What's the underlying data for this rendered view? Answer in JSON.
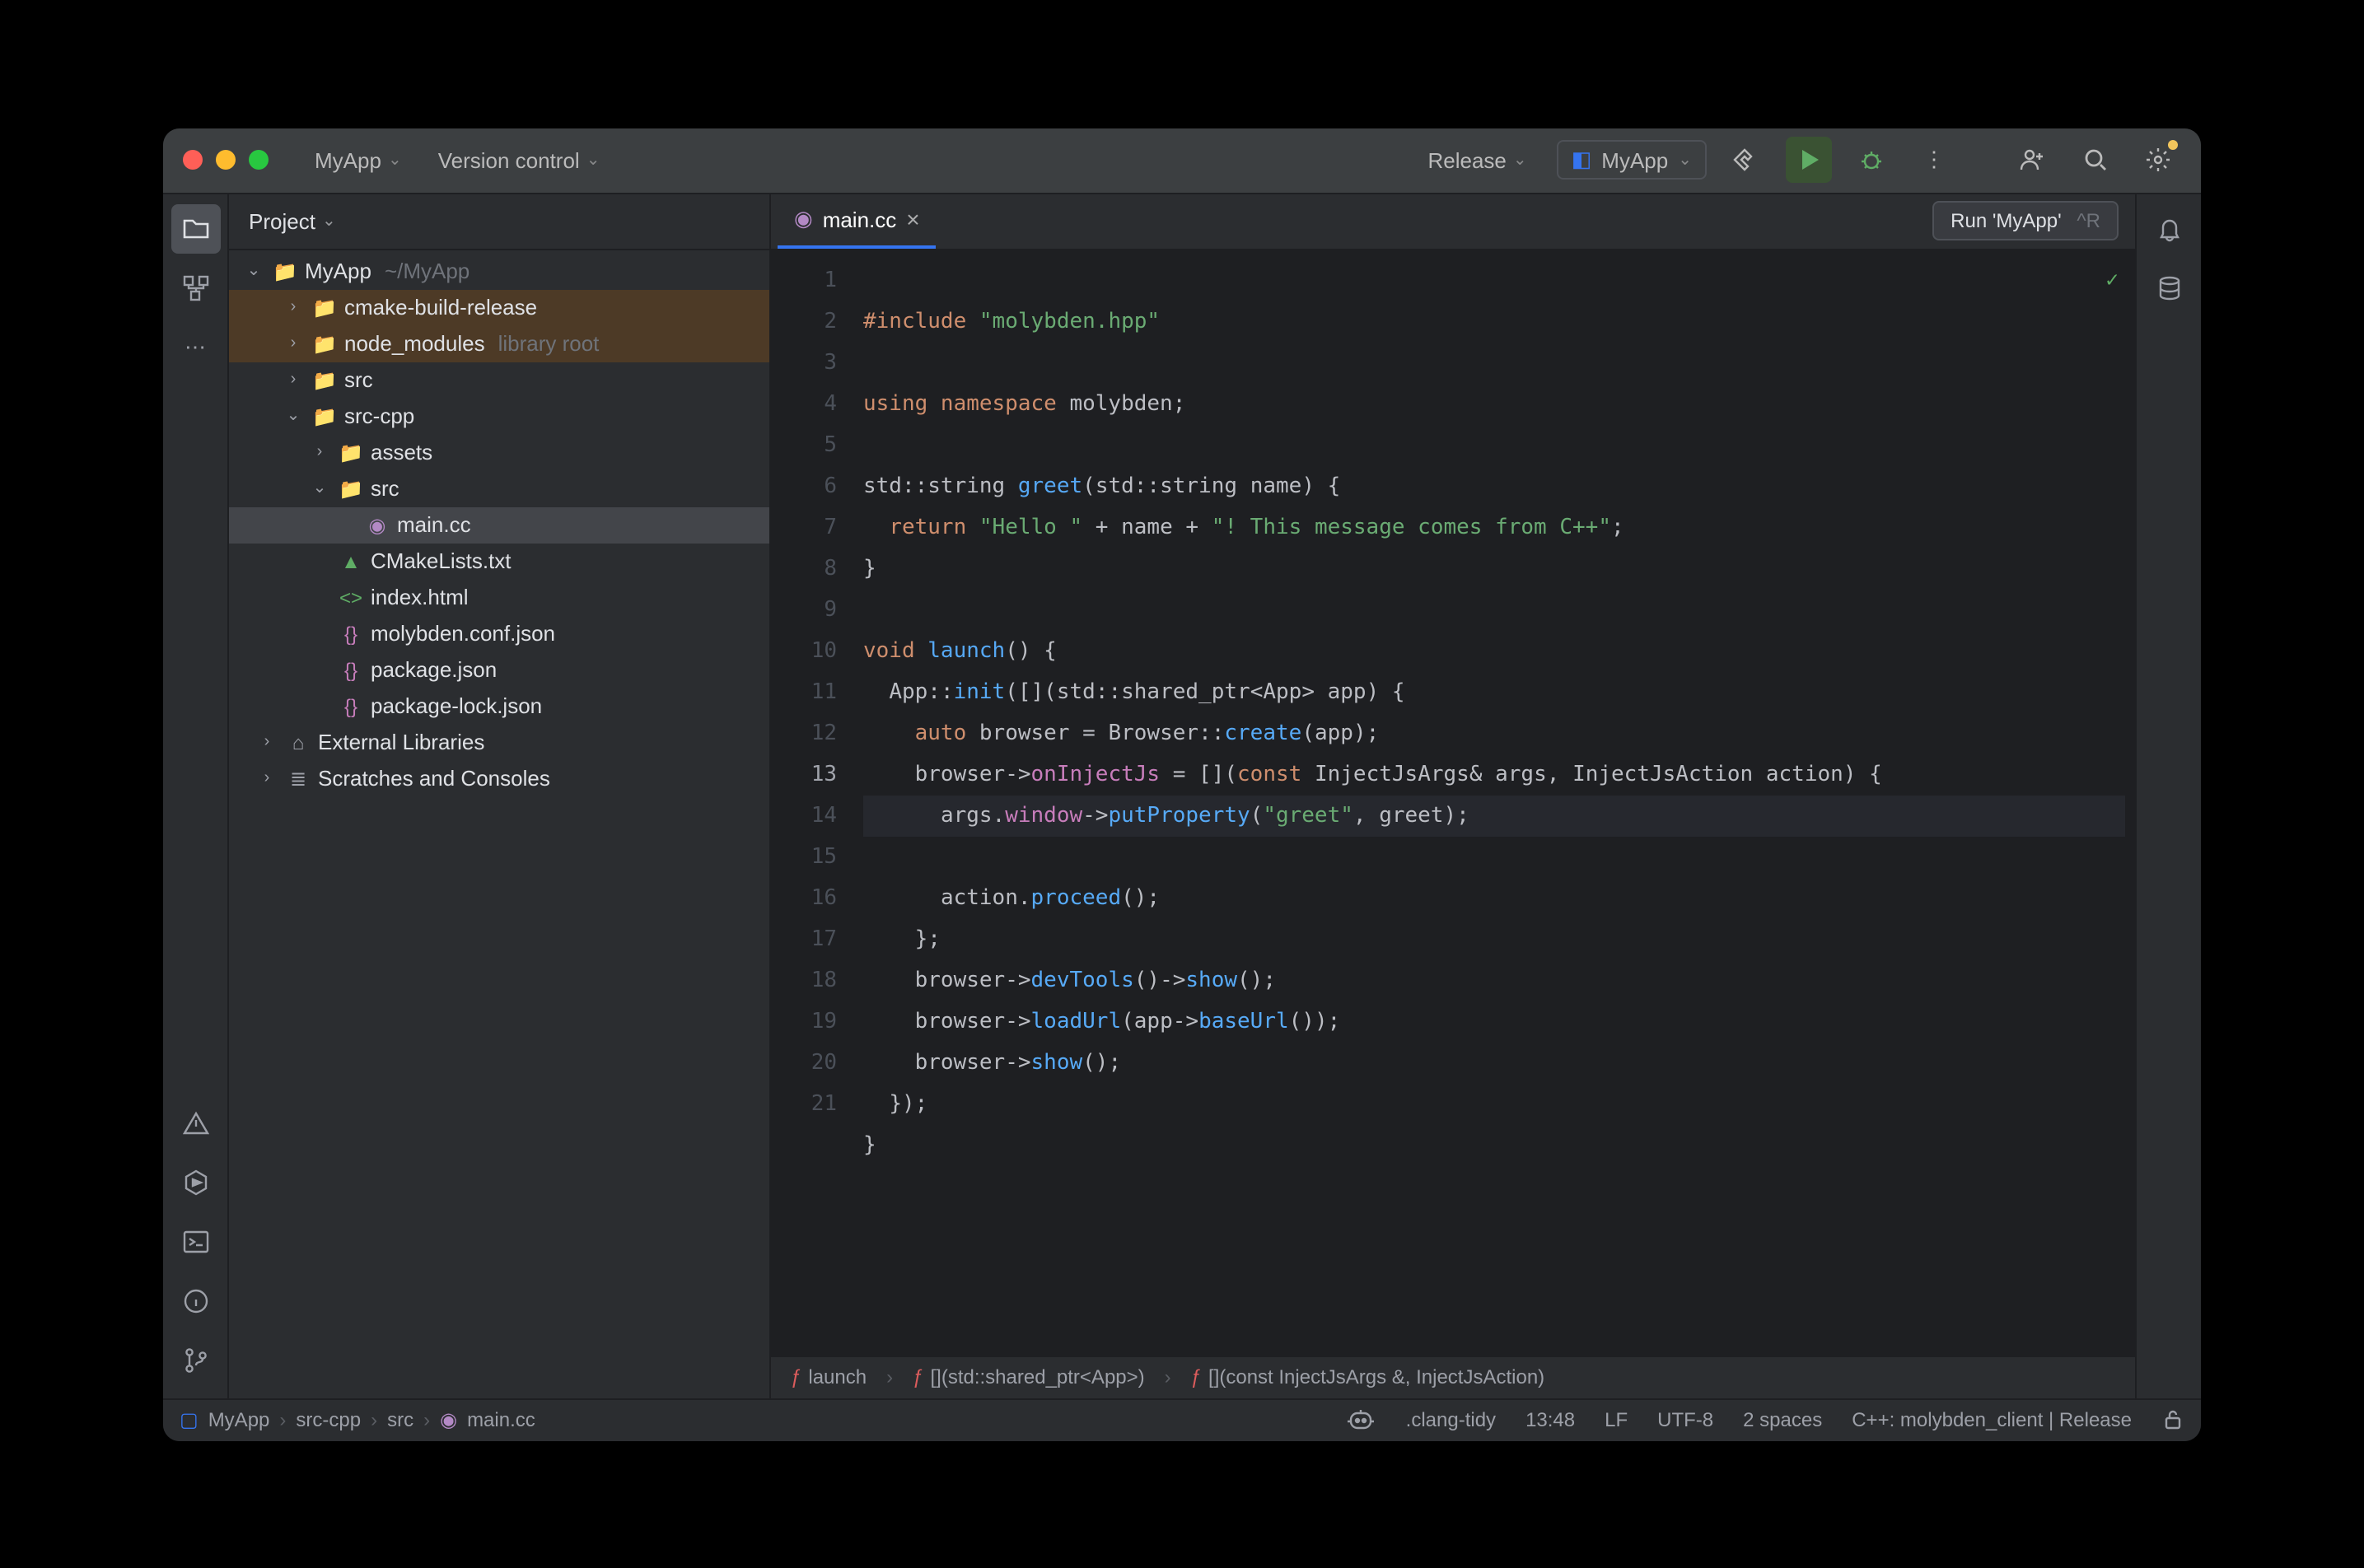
{
  "titlebar": {
    "menu1": "MyApp",
    "menu2": "Version control",
    "build_type": "Release",
    "active_config": "MyApp"
  },
  "tooltip": {
    "label": "Run 'MyApp'",
    "shortcut": "^R"
  },
  "sidepanel": {
    "title": "Project"
  },
  "tree": {
    "root": {
      "name": "MyApp",
      "hint": "~/MyApp"
    },
    "items": [
      {
        "name": "cmake-build-release",
        "depth": 1,
        "arrow": ">",
        "icon": "folder",
        "cls": "root-highlight"
      },
      {
        "name": "node_modules",
        "hint": "library root",
        "depth": 1,
        "arrow": ">",
        "icon": "folder",
        "cls": "root-highlight"
      },
      {
        "name": "src",
        "depth": 1,
        "arrow": ">",
        "icon": "folder"
      },
      {
        "name": "src-cpp",
        "depth": 1,
        "arrow": "v",
        "icon": "folder"
      },
      {
        "name": "assets",
        "depth": 2,
        "arrow": ">",
        "icon": "folder"
      },
      {
        "name": "src",
        "depth": 2,
        "arrow": "v",
        "icon": "folder"
      },
      {
        "name": "main.cc",
        "depth": 3,
        "arrow": "",
        "icon": "cpp",
        "cls": "selected"
      },
      {
        "name": "CMakeLists.txt",
        "depth": 2,
        "arrow": "",
        "icon": "cmake"
      },
      {
        "name": "index.html",
        "depth": 2,
        "arrow": "",
        "icon": "html"
      },
      {
        "name": "molybden.conf.json",
        "depth": 2,
        "arrow": "",
        "icon": "json"
      },
      {
        "name": "package.json",
        "depth": 2,
        "arrow": "",
        "icon": "json"
      },
      {
        "name": "package-lock.json",
        "depth": 2,
        "arrow": "",
        "icon": "json"
      },
      {
        "name": "External Libraries",
        "depth": 0,
        "arrow": ">",
        "icon": "lib"
      },
      {
        "name": "Scratches and Consoles",
        "depth": 0,
        "arrow": ">",
        "icon": "scratch"
      }
    ]
  },
  "tab": {
    "label": "main.cc"
  },
  "code": {
    "lines": 20,
    "current_line": 13
  },
  "editor_crumbs": {
    "c1": "launch",
    "c2": "[](std::shared_ptr<App>)",
    "c3": "[](const InjectJsArgs &, InjectJsAction)"
  },
  "status": {
    "path": [
      "MyApp",
      "src-cpp",
      "src",
      "main.cc"
    ],
    "clang": ".clang-tidy",
    "pos": "13:48",
    "eol": "LF",
    "enc": "UTF-8",
    "indent": "2 spaces",
    "context": "C++: molybden_client | Release"
  }
}
